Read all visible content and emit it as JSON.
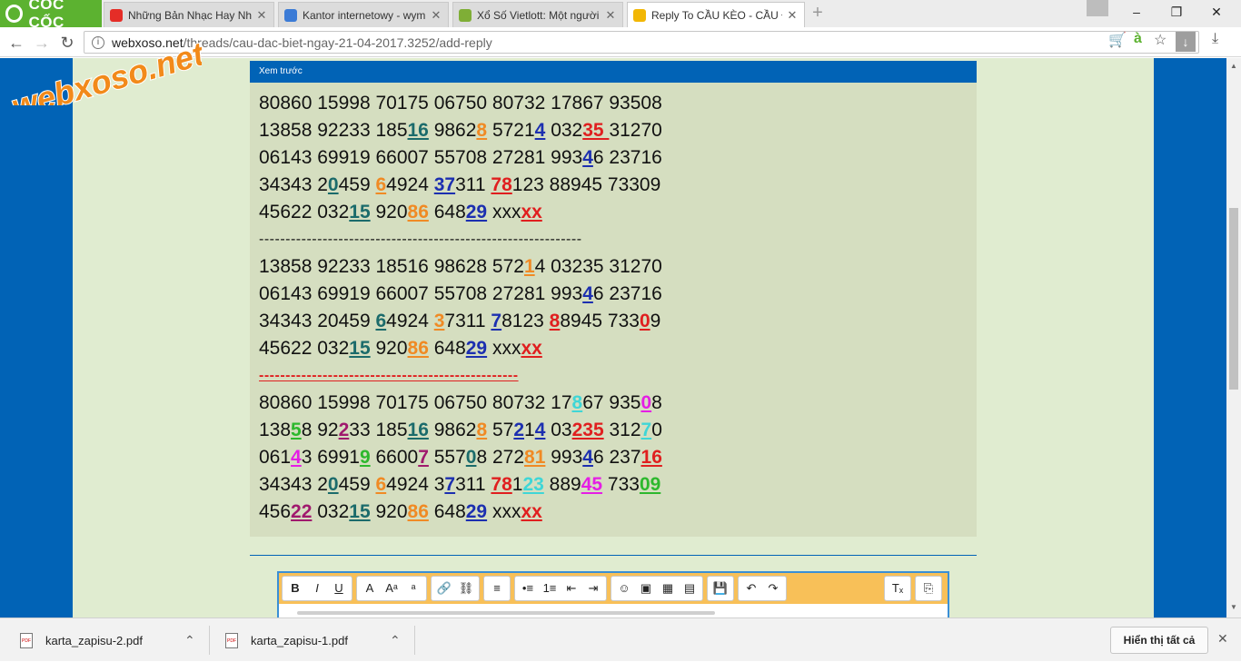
{
  "browser": {
    "brand": "CỐC CỐC",
    "tabs": [
      {
        "title": "Những Bản Nhạc Hay Nhất",
        "favicon_color": "#e52d27",
        "active": false
      },
      {
        "title": "Kantor internetowy - wymi",
        "favicon_color": "#3b7bd6",
        "active": false
      },
      {
        "title": "Xổ Số Vietlott: Một người t",
        "favicon_color": "#7fae36",
        "active": false
      },
      {
        "title": "Reply To CẦU KÈO - CẦU Đ",
        "favicon_color": "#f2b705",
        "active": true
      }
    ],
    "window_buttons": {
      "minimize": "–",
      "restore": "❐",
      "close": "✕"
    },
    "url": {
      "host": "webxoso.net",
      "path": "/threads/cau-dac-biet-ngay-21-04-2017.3252/add-reply"
    },
    "icons": [
      "back-icon",
      "forward-icon",
      "reload-icon",
      "info-icon",
      "cart-icon",
      "translate-icon",
      "star-icon",
      "download-icon"
    ]
  },
  "watermark": "webxoso.net",
  "preview": {
    "header": "Xem trước",
    "blocks": [
      {
        "type": "rows",
        "rows": [
          [
            [
              "80860 15998 70175 06750 80732 17867 93508",
              null
            ]
          ],
          [
            [
              "13858 92233 185",
              null
            ],
            [
              "16",
              "#1b6b6b"
            ],
            [
              " 9862",
              null
            ],
            [
              "8",
              "#f08a24"
            ],
            [
              " 5721",
              null
            ],
            [
              "4",
              "#1c2fb0"
            ],
            [
              " 032",
              null
            ],
            [
              "35 ",
              "#e01f1f"
            ],
            [
              "31270",
              null
            ]
          ],
          [
            [
              "06143 69919 66007 55708 27281 993",
              null
            ],
            [
              "4",
              "#1c2fb0"
            ],
            [
              "6 23716",
              null
            ]
          ],
          [
            [
              "34343 2",
              null
            ],
            [
              "0",
              "#1b6b6b"
            ],
            [
              "459 ",
              null
            ],
            [
              "6",
              "#f08a24"
            ],
            [
              "4924 ",
              null
            ],
            [
              "37",
              "#1c2fb0"
            ],
            [
              "311 ",
              null
            ],
            [
              "78",
              "#e01f1f"
            ],
            [
              "123 88945 73309",
              null
            ]
          ],
          [
            [
              "45622 032",
              null
            ],
            [
              "15",
              "#1b6b6b"
            ],
            [
              " 920",
              null
            ],
            [
              "86",
              "#f08a24"
            ],
            [
              " 648",
              null
            ],
            [
              "29",
              "#1c2fb0"
            ],
            [
              " xxx",
              null
            ],
            [
              "xx",
              "#e01f1f"
            ]
          ]
        ]
      },
      {
        "type": "dash",
        "text": "-------------------------------------------------------------",
        "red": false
      },
      {
        "type": "rows",
        "rows": [
          [
            [
              "13858 92233 18516 98628 572",
              null
            ],
            [
              "1",
              "#f08a24"
            ],
            [
              "4 03235 31270",
              null
            ]
          ],
          [
            [
              "06143 69919 66007 55708 27281 993",
              null
            ],
            [
              "4",
              "#1c2fb0"
            ],
            [
              "6 23716",
              null
            ]
          ],
          [
            [
              "34343 20459 ",
              null
            ],
            [
              "6",
              "#1b6b6b"
            ],
            [
              "4924 ",
              null
            ],
            [
              "3",
              "#f08a24"
            ],
            [
              "7311 ",
              null
            ],
            [
              "7",
              "#1c2fb0"
            ],
            [
              "8123 ",
              null
            ],
            [
              "8",
              "#e01f1f"
            ],
            [
              "8945 733",
              null
            ],
            [
              "0",
              "#e01f1f"
            ],
            [
              "9",
              null
            ]
          ],
          [
            [
              "45622 032",
              null
            ],
            [
              "15",
              "#1b6b6b"
            ],
            [
              " 920",
              null
            ],
            [
              "86",
              "#f08a24"
            ],
            [
              " 648",
              null
            ],
            [
              "29",
              "#1c2fb0"
            ],
            [
              " xxx",
              null
            ],
            [
              "xx",
              "#e01f1f"
            ]
          ]
        ]
      },
      {
        "type": "dash",
        "text": "-------------------------------------------------",
        "red": true
      },
      {
        "type": "rows",
        "rows": [
          [
            [
              "80860 15998 70175 06750 80732 17",
              null
            ],
            [
              "8",
              "#3fd6d6"
            ],
            [
              "67 935",
              null
            ],
            [
              "0",
              "#e51ee5"
            ],
            [
              "8",
              null
            ]
          ],
          [
            [
              "138",
              null
            ],
            [
              "5",
              "#2db82d"
            ],
            [
              "8 92",
              null
            ],
            [
              "2",
              "#a0196d"
            ],
            [
              "33 185",
              null
            ],
            [
              "16",
              "#1b6b6b"
            ],
            [
              " 9862",
              null
            ],
            [
              "8",
              "#f08a24"
            ],
            [
              " 57",
              null
            ],
            [
              "2",
              "#1c2fb0"
            ],
            [
              "1",
              null
            ],
            [
              "4",
              "#1c2fb0"
            ],
            [
              " 03",
              null
            ],
            [
              "235",
              "#e01f1f"
            ],
            [
              " 312",
              null
            ],
            [
              "7",
              "#3fd6d6"
            ],
            [
              "0",
              null
            ]
          ],
          [
            [
              "061",
              null
            ],
            [
              "4",
              "#e51ee5"
            ],
            [
              "3 6991",
              null
            ],
            [
              "9",
              "#2db82d"
            ],
            [
              " 6600",
              null
            ],
            [
              "7",
              "#a0196d"
            ],
            [
              " 557",
              null
            ],
            [
              "0",
              "#1b6b6b"
            ],
            [
              "8 272",
              null
            ],
            [
              "81",
              "#f08a24"
            ],
            [
              " 993",
              null
            ],
            [
              "4",
              "#1c2fb0"
            ],
            [
              "6 237",
              null
            ],
            [
              "16",
              "#e01f1f"
            ]
          ],
          [
            [
              "34343 2",
              null
            ],
            [
              "0",
              "#1b6b6b"
            ],
            [
              "459 ",
              null
            ],
            [
              "6",
              "#f08a24"
            ],
            [
              "4924 3",
              null
            ],
            [
              "7",
              "#1c2fb0"
            ],
            [
              "311 ",
              null
            ],
            [
              "78",
              "#e01f1f"
            ],
            [
              "1",
              null
            ],
            [
              "23",
              "#3fd6d6"
            ],
            [
              " 889",
              null
            ],
            [
              "45",
              "#e51ee5"
            ],
            [
              " 733",
              null
            ],
            [
              "09",
              "#2db82d"
            ]
          ],
          [
            [
              "456",
              null
            ],
            [
              "22",
              "#a0196d"
            ],
            [
              " 032",
              null
            ],
            [
              "15",
              "#1b6b6b"
            ],
            [
              " 920",
              null
            ],
            [
              "86",
              "#f08a24"
            ],
            [
              " 648",
              null
            ],
            [
              "29",
              "#1c2fb0"
            ],
            [
              " xxx",
              null
            ],
            [
              "xx",
              "#e01f1f"
            ]
          ]
        ]
      }
    ]
  },
  "editor": {
    "toolbar_groups": [
      [
        {
          "name": "bold-button",
          "glyph": "B"
        },
        {
          "name": "italic-button",
          "glyph": "I"
        },
        {
          "name": "underline-button",
          "glyph": "U"
        }
      ],
      [
        {
          "name": "text-color-button",
          "glyph": "A"
        },
        {
          "name": "font-size-button",
          "glyph": "Aᵃ"
        },
        {
          "name": "font-family-button",
          "glyph": "ᵃ"
        }
      ],
      [
        {
          "name": "link-button",
          "glyph": "🔗"
        },
        {
          "name": "unlink-button",
          "glyph": "⛓"
        }
      ],
      [
        {
          "name": "align-button",
          "glyph": "≡"
        }
      ],
      [
        {
          "name": "bullet-list-button",
          "glyph": "•≡"
        },
        {
          "name": "numbered-list-button",
          "glyph": "1≡"
        },
        {
          "name": "outdent-button",
          "glyph": "⇤"
        },
        {
          "name": "indent-button",
          "glyph": "⇥"
        }
      ],
      [
        {
          "name": "smilie-button",
          "glyph": "☺"
        },
        {
          "name": "image-button",
          "glyph": "▣"
        },
        {
          "name": "media-button",
          "glyph": "▦"
        },
        {
          "name": "quote-button",
          "glyph": "▤"
        }
      ],
      [
        {
          "name": "save-draft-button",
          "glyph": "💾"
        }
      ],
      [
        {
          "name": "undo-button",
          "glyph": "↶"
        },
        {
          "name": "redo-button",
          "glyph": "↷"
        }
      ]
    ],
    "toolbar_right": [
      {
        "name": "remove-format-button",
        "glyph": "Tₓ"
      },
      {
        "name": "toggle-source-button",
        "glyph": "⎘"
      }
    ]
  },
  "downloads": {
    "items": [
      {
        "filename": "karta_zapisu-2.pdf"
      },
      {
        "filename": "karta_zapisu-1.pdf"
      }
    ],
    "show_all": "Hiển thị tất cả"
  }
}
